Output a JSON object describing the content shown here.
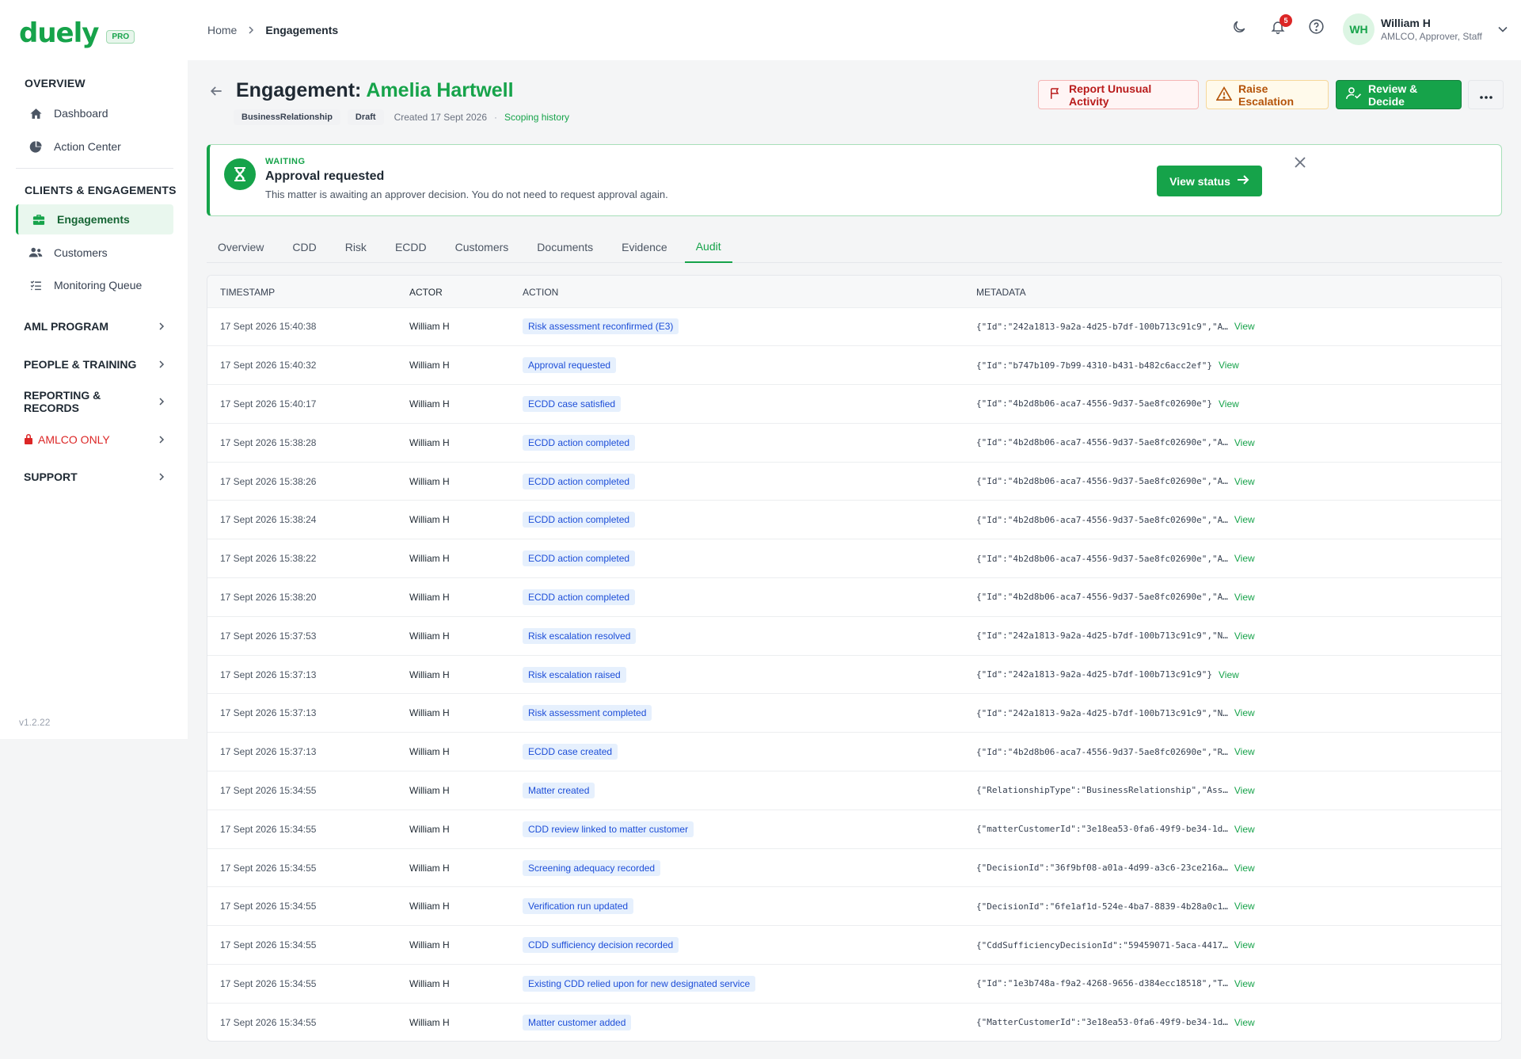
{
  "brand": {
    "name": "duely",
    "badge": "PRO"
  },
  "sidebar": {
    "overview_heading": "OVERVIEW",
    "overview_items": [
      {
        "label": "Dashboard",
        "icon": "home-icon"
      },
      {
        "label": "Action Center",
        "icon": "pie-chart-icon"
      }
    ],
    "clients_heading": "CLIENTS & ENGAGEMENTS",
    "clients_items": [
      {
        "label": "Engagements",
        "icon": "briefcase-icon",
        "active": true
      },
      {
        "label": "Customers",
        "icon": "users-icon"
      },
      {
        "label": "Monitoring Queue",
        "icon": "checklist-icon"
      }
    ],
    "groups": [
      {
        "label": "AML PROGRAM"
      },
      {
        "label": "PEOPLE & TRAINING"
      },
      {
        "label": "REPORTING & RECORDS"
      },
      {
        "label": "AMLCO ONLY",
        "icon": "lock-icon",
        "color": "#dc2626"
      },
      {
        "label": "SUPPORT"
      }
    ],
    "version": "v1.2.22"
  },
  "header": {
    "breadcrumb": [
      "Home",
      "Engagements"
    ],
    "notifications_count": "5",
    "user": {
      "initials": "WH",
      "name": "William H",
      "roles": "AMLCO, Approver, Staff"
    }
  },
  "engagement": {
    "title_prefix": "Engagement:",
    "client_name": "Amelia Hartwell",
    "type_chip": "BusinessRelationship",
    "status_chip": "Draft",
    "created": "Created 17 Sept 2026",
    "separator": "·",
    "scoping_link": "Scoping history"
  },
  "actions": {
    "report": "Report Unusual Activity",
    "escalate": "Raise Escalation",
    "review": "Review & Decide"
  },
  "banner": {
    "kicker": "WAITING",
    "title": "Approval requested",
    "text": "This matter is awaiting an approver decision. You do not need to request approval again.",
    "button": "View status"
  },
  "tabs": [
    {
      "label": "Overview"
    },
    {
      "label": "CDD"
    },
    {
      "label": "Risk"
    },
    {
      "label": "ECDD"
    },
    {
      "label": "Customers"
    },
    {
      "label": "Documents"
    },
    {
      "label": "Evidence"
    },
    {
      "label": "Audit",
      "active": true
    }
  ],
  "audit": {
    "columns": {
      "timestamp": "TIMESTAMP",
      "actor": "ACTOR",
      "action": "ACTION",
      "metadata": "METADATA"
    },
    "view_label": "View",
    "rows": [
      {
        "timestamp": "17 Sept 2026 15:40:38",
        "actor": "William H",
        "action": "Risk assessment reconfirmed (E3)",
        "metadata": "{\"Id\":\"242a1813-9a2a-4d25-b7df-100b713c91c9\",\"A…"
      },
      {
        "timestamp": "17 Sept 2026 15:40:32",
        "actor": "William H",
        "action": "Approval requested",
        "metadata": "{\"Id\":\"b747b109-7b99-4310-b431-b482c6acc2ef\"}"
      },
      {
        "timestamp": "17 Sept 2026 15:40:17",
        "actor": "William H",
        "action": "ECDD case satisfied",
        "metadata": "{\"Id\":\"4b2d8b06-aca7-4556-9d37-5ae8fc02690e\"}"
      },
      {
        "timestamp": "17 Sept 2026 15:38:28",
        "actor": "William H",
        "action": "ECDD action completed",
        "metadata": "{\"Id\":\"4b2d8b06-aca7-4556-9d37-5ae8fc02690e\",\"A…"
      },
      {
        "timestamp": "17 Sept 2026 15:38:26",
        "actor": "William H",
        "action": "ECDD action completed",
        "metadata": "{\"Id\":\"4b2d8b06-aca7-4556-9d37-5ae8fc02690e\",\"A…"
      },
      {
        "timestamp": "17 Sept 2026 15:38:24",
        "actor": "William H",
        "action": "ECDD action completed",
        "metadata": "{\"Id\":\"4b2d8b06-aca7-4556-9d37-5ae8fc02690e\",\"A…"
      },
      {
        "timestamp": "17 Sept 2026 15:38:22",
        "actor": "William H",
        "action": "ECDD action completed",
        "metadata": "{\"Id\":\"4b2d8b06-aca7-4556-9d37-5ae8fc02690e\",\"A…"
      },
      {
        "timestamp": "17 Sept 2026 15:38:20",
        "actor": "William H",
        "action": "ECDD action completed",
        "metadata": "{\"Id\":\"4b2d8b06-aca7-4556-9d37-5ae8fc02690e\",\"A…"
      },
      {
        "timestamp": "17 Sept 2026 15:37:53",
        "actor": "William H",
        "action": "Risk escalation resolved",
        "metadata": "{\"Id\":\"242a1813-9a2a-4d25-b7df-100b713c91c9\",\"N…"
      },
      {
        "timestamp": "17 Sept 2026 15:37:13",
        "actor": "William H",
        "action": "Risk escalation raised",
        "metadata": "{\"Id\":\"242a1813-9a2a-4d25-b7df-100b713c91c9\"}"
      },
      {
        "timestamp": "17 Sept 2026 15:37:13",
        "actor": "William H",
        "action": "Risk assessment completed",
        "metadata": "{\"Id\":\"242a1813-9a2a-4d25-b7df-100b713c91c9\",\"N…"
      },
      {
        "timestamp": "17 Sept 2026 15:37:13",
        "actor": "William H",
        "action": "ECDD case created",
        "metadata": "{\"Id\":\"4b2d8b06-aca7-4556-9d37-5ae8fc02690e\",\"R…"
      },
      {
        "timestamp": "17 Sept 2026 15:34:55",
        "actor": "William H",
        "action": "Matter created",
        "metadata": "{\"RelationshipType\":\"BusinessRelationship\",\"Ass…"
      },
      {
        "timestamp": "17 Sept 2026 15:34:55",
        "actor": "William H",
        "action": "CDD review linked to matter customer",
        "metadata": "{\"matterCustomerId\":\"3e18ea53-0fa6-49f9-be34-1d…"
      },
      {
        "timestamp": "17 Sept 2026 15:34:55",
        "actor": "William H",
        "action": "Screening adequacy recorded",
        "metadata": "{\"DecisionId\":\"36f9bf08-a01a-4d99-a3c6-23ce216a…"
      },
      {
        "timestamp": "17 Sept 2026 15:34:55",
        "actor": "William H",
        "action": "Verification run updated",
        "metadata": "{\"DecisionId\":\"6fe1af1d-524e-4ba7-8839-4b28a0c1…"
      },
      {
        "timestamp": "17 Sept 2026 15:34:55",
        "actor": "William H",
        "action": "CDD sufficiency decision recorded",
        "metadata": "{\"CddSufficiencyDecisionId\":\"59459071-5aca-4417…"
      },
      {
        "timestamp": "17 Sept 2026 15:34:55",
        "actor": "William H",
        "action": "Existing CDD relied upon for new designated service",
        "metadata": "{\"Id\":\"1e3b748a-f9a2-4268-9656-d384ecc18518\",\"T…"
      },
      {
        "timestamp": "17 Sept 2026 15:34:55",
        "actor": "William H",
        "action": "Matter customer added",
        "metadata": "{\"MatterCustomerId\":\"3e18ea53-0fa6-49f9-be34-1d…"
      }
    ]
  },
  "colors": {
    "brand_green": "#16a34a",
    "danger": "#dc2626",
    "warning": "#b45309",
    "pill_blue": "#1d4ed8"
  }
}
